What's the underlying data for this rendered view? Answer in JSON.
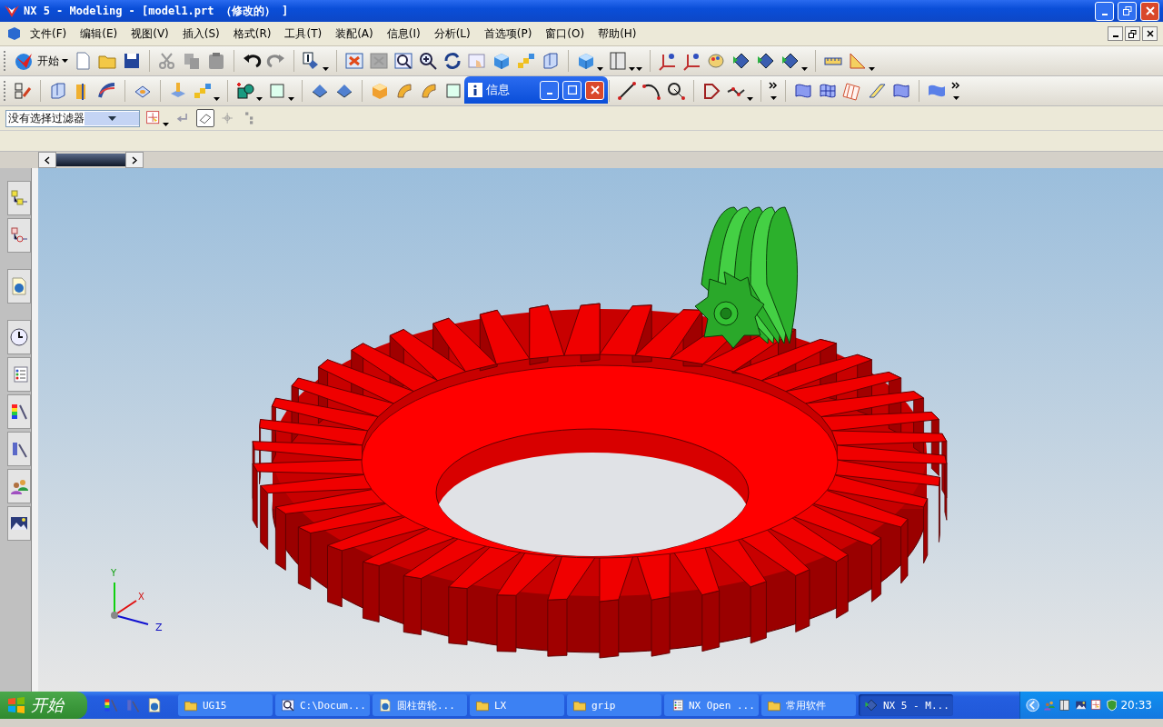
{
  "window": {
    "title": "NX 5 - Modeling - [model1.prt （修改的） ]"
  },
  "menu": [
    "文件(F)",
    "编辑(E)",
    "视图(V)",
    "插入(S)",
    "格式(R)",
    "工具(T)",
    "装配(A)",
    "信息(I)",
    "分析(L)",
    "首选项(P)",
    "窗口(O)",
    "帮助(H)"
  ],
  "toolbar": {
    "start_label": "开始"
  },
  "selection_filter": {
    "value": "没有选择过滤器"
  },
  "info_dialog": {
    "title": "信息"
  },
  "axes": {
    "x": "X",
    "y": "Y",
    "z": "Z"
  },
  "taskbar": {
    "start": "开始",
    "tasks": [
      {
        "label": "UG15",
        "selected": false
      },
      {
        "label": "C:\\Docum...",
        "selected": false
      },
      {
        "label": "圆柱齿轮...",
        "selected": false
      },
      {
        "label": "LX",
        "selected": false
      },
      {
        "label": "grip",
        "selected": false
      },
      {
        "label": "NX Open ...",
        "selected": false
      },
      {
        "label": "常用软件",
        "selected": false
      },
      {
        "label": "NX 5 - M...",
        "selected": true
      }
    ],
    "clock": "20:33"
  }
}
